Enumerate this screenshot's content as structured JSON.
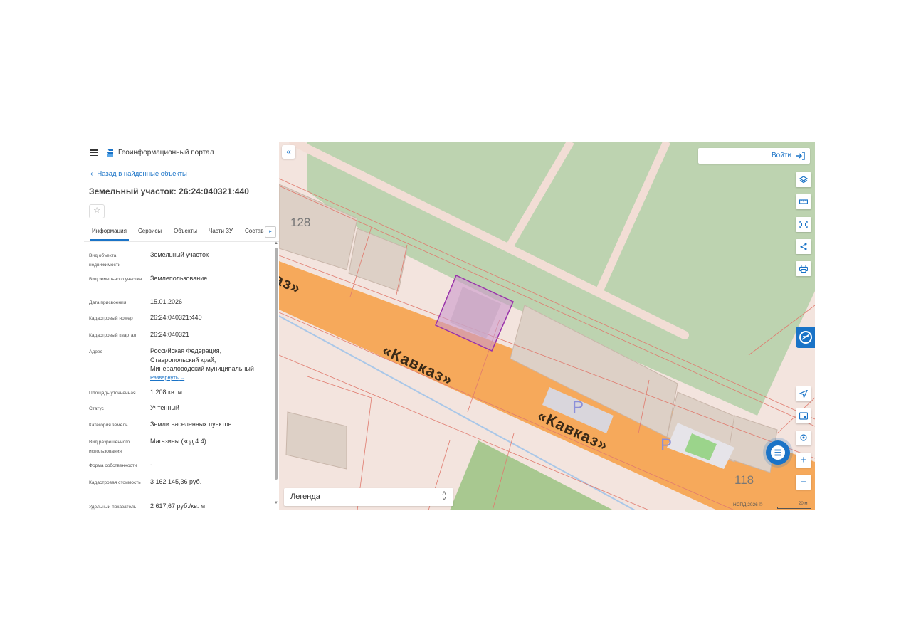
{
  "portal": {
    "name": "Геоинформационный портал"
  },
  "nav": {
    "back_label": "Назад в найденные объекты"
  },
  "object": {
    "title": "Земельный участок: 26:24:040321:440"
  },
  "tabs": [
    {
      "label": "Информация"
    },
    {
      "label": "Сервисы"
    },
    {
      "label": "Объекты"
    },
    {
      "label": "Части ЗУ"
    },
    {
      "label": "Состав"
    }
  ],
  "attributes": [
    {
      "label": "Вид объекта недвижимости",
      "value": "Земельный участок"
    },
    {
      "label": "Вид земельного участка",
      "value": "Землепользование"
    },
    {
      "label": "Дата присвоения",
      "value": "15.01.2026"
    },
    {
      "label": "Кадастровый номер",
      "value": "26:24:040321:440"
    },
    {
      "label": "Кадастровый квартал",
      "value": "26:24:040321"
    },
    {
      "label": "Адрес",
      "value": "Российская Федерация, Ставропольский край, Минераловодский муниципальный"
    },
    {
      "label": "Площадь уточненная",
      "value": "1 208 кв. м"
    },
    {
      "label": "Статус",
      "value": "Учтенный"
    },
    {
      "label": "Категория земель",
      "value": "Земли населенных пунктов"
    },
    {
      "label": "Вид разрешенного использования",
      "value": "Магазины (код 4.4)"
    },
    {
      "label": "Форма собственности",
      "value": "-"
    },
    {
      "label": "Кадастровая стоимость",
      "value": "3 162 145,36 руб."
    },
    {
      "label": "Удельный показатель",
      "value": "2 617,67 руб./кв. м"
    }
  ],
  "address_expand_label": "Развернуть",
  "map": {
    "login_label": "Войти",
    "legend_label": "Легенда",
    "attribution": "НСПД 2026 ©",
    "scale_label": "20 м",
    "labels": {
      "road_1": "«Кавказ»",
      "road_2": "«Кавказ»",
      "road_edge": "аз»",
      "house_128": "128",
      "house_118": "118",
      "parking_1": "P",
      "parking_2": "P"
    },
    "colors": {
      "road": "#f6a95b",
      "green": "#bdd3b0",
      "parcel_fill": "#cc99cc",
      "accent": "#1a73c7"
    }
  }
}
